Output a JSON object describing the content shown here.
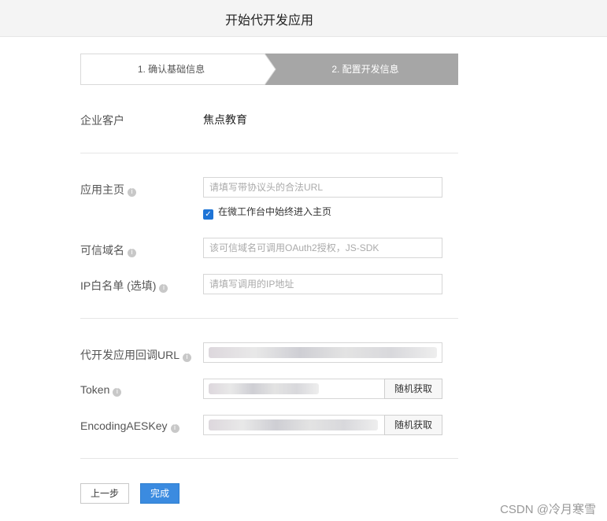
{
  "header": {
    "title": "开始代开发应用"
  },
  "steps": {
    "step1": "1. 确认基础信息",
    "step2": "2. 配置开发信息"
  },
  "customer": {
    "label": "企业客户",
    "value": "焦点教育"
  },
  "form": {
    "homepage": {
      "label": "应用主页",
      "placeholder": "请填写带协议头的合法URL",
      "checkbox_label": "在微工作台中始终进入主页",
      "checked": true
    },
    "trusted_domain": {
      "label": "可信域名",
      "placeholder": "该可信域名可调用OAuth2授权，JS-SDK"
    },
    "ip_whitelist": {
      "label": "IP白名单 (选填)",
      "placeholder": "请填写调用的IP地址"
    },
    "callback_url": {
      "label": "代开发应用回调URL"
    },
    "token": {
      "label": "Token",
      "random_button": "随机获取"
    },
    "aes_key": {
      "label": "EncodingAESKey",
      "random_button": "随机获取"
    }
  },
  "actions": {
    "prev": "上一步",
    "done": "完成"
  },
  "watermark": "CSDN @冷月寒雪",
  "colors": {
    "primary": "#3b8be0",
    "step_active": "#a6a6a6"
  }
}
